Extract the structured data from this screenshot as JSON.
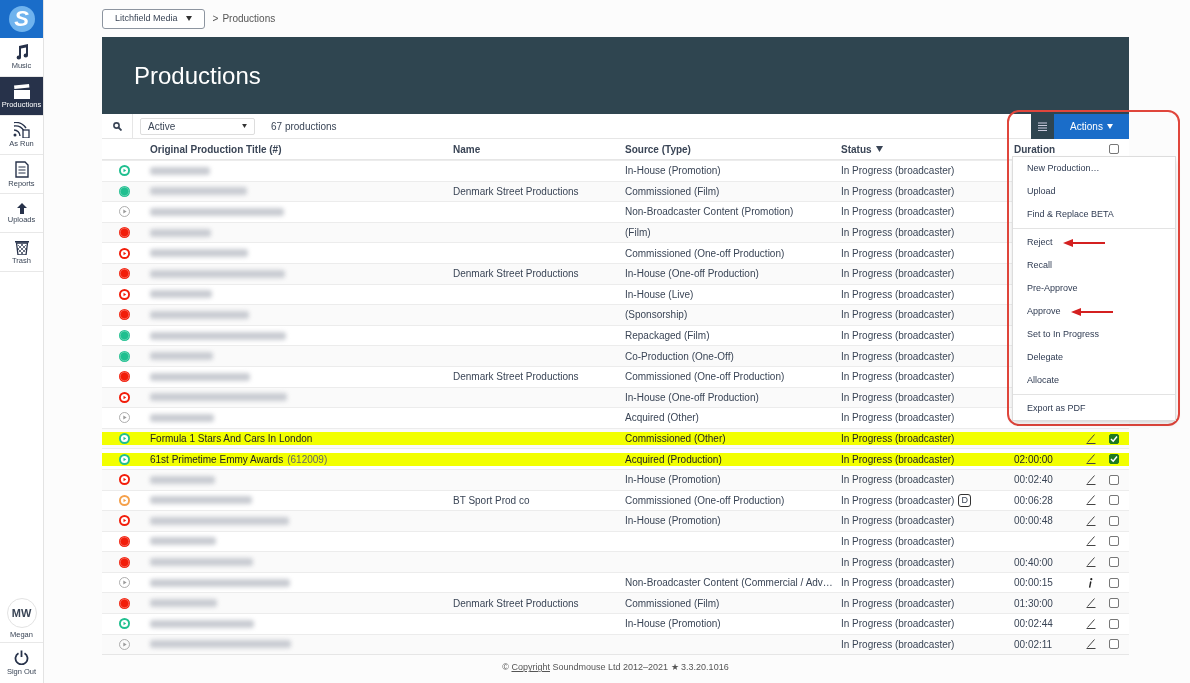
{
  "sidebar": {
    "logo_text": "S",
    "items": [
      {
        "label": "Music",
        "kind": "music",
        "selected": false
      },
      {
        "label": "Productions",
        "kind": "clapper",
        "selected": true
      },
      {
        "label": "As Run",
        "kind": "asrun",
        "selected": false
      },
      {
        "label": "Reports",
        "kind": "report",
        "selected": false
      },
      {
        "label": "Uploads",
        "kind": "upload",
        "selected": false
      },
      {
        "label": "Trash",
        "kind": "trash",
        "selected": false
      }
    ],
    "user": {
      "initials": "MW",
      "name": "Megan"
    },
    "sign_out": "Sign Out"
  },
  "breadcrumb": {
    "account": "Litchfield Media",
    "separator": ">",
    "page": "Productions"
  },
  "page_title": "Productions",
  "toolbar": {
    "filter": "Active",
    "count": "67 productions",
    "actions_button": "Actions"
  },
  "table": {
    "columns": [
      "Original Production Title (#)",
      "Name",
      "Source (Type)",
      "Status",
      "Duration"
    ],
    "select_all_checked": false,
    "rows": [
      {
        "kind": "play",
        "color": "#1fbf8f",
        "redacted": true,
        "highlighted": false,
        "name": "",
        "source": "In-House (Promotion)",
        "status": "In Progress (broadcaster)"
      },
      {
        "kind": "dot",
        "color": "#1fbf8f",
        "redacted": true,
        "highlighted": false,
        "name": "Denmark Street Productions",
        "source": "Commissioned (Film)",
        "status": "In Progress (broadcaster)"
      },
      {
        "kind": "outline",
        "redacted": true,
        "highlighted": false,
        "name": "",
        "source": "Non-Broadcaster Content (Promotion)",
        "status": "In Progress (broadcaster)"
      },
      {
        "kind": "dot",
        "color": "#f21d0a",
        "redacted": true,
        "highlighted": false,
        "name": "",
        "source": "(Film)",
        "status": "In Progress (broadcaster)"
      },
      {
        "kind": "play",
        "color": "#f21d0a",
        "redacted": true,
        "highlighted": false,
        "name": "",
        "source": "Commissioned (One-off Production)",
        "status": "In Progress (broadcaster)"
      },
      {
        "kind": "dot",
        "color": "#f21d0a",
        "redacted": true,
        "highlighted": false,
        "name": "Denmark Street Productions",
        "source": "In-House (One-off Production)",
        "status": "In Progress (broadcaster)"
      },
      {
        "kind": "play",
        "color": "#f21d0a",
        "redacted": true,
        "highlighted": false,
        "name": "",
        "source": "In-House (Live)",
        "status": "In Progress (broadcaster)"
      },
      {
        "kind": "dot",
        "color": "#f21d0a",
        "redacted": true,
        "highlighted": false,
        "name": "",
        "source": "(Sponsorship)",
        "status": "In Progress (broadcaster)"
      },
      {
        "kind": "dot",
        "color": "#1fbf8f",
        "redacted": true,
        "highlighted": false,
        "name": "",
        "source": "Repackaged (Film)",
        "status": "In Progress (broadcaster)"
      },
      {
        "kind": "dot",
        "color": "#1fbf8f",
        "redacted": true,
        "highlighted": false,
        "name": "",
        "source": "Co-Production (One-Off)",
        "status": "In Progress (broadcaster)"
      },
      {
        "kind": "dot",
        "color": "#f21d0a",
        "redacted": true,
        "highlighted": false,
        "name": "Denmark Street Productions",
        "source": "Commissioned (One-off Production)",
        "status": "In Progress (broadcaster)"
      },
      {
        "kind": "play",
        "color": "#f21d0a",
        "redacted": true,
        "highlighted": false,
        "name": "",
        "source": "In-House (One-off Production)",
        "status": "In Progress (broadcaster)"
      },
      {
        "kind": "outline",
        "redacted": true,
        "highlighted": false,
        "name": "",
        "source": "Acquired (Other)",
        "status": "In Progress (broadcaster)"
      },
      {
        "kind": "play",
        "color": "#1fbf8f",
        "redacted": false,
        "title": "Formula 1 Stars And Cars In London",
        "highlighted": true,
        "name": "",
        "source": "Commissioned (Other)",
        "status": "In Progress (broadcaster)",
        "duration": "",
        "action": {
          "kind": "edit"
        },
        "checked": true
      },
      {
        "kind": "play",
        "color": "#1fbf8f",
        "redacted": false,
        "title": "61st Primetime Emmy Awards",
        "number": "(612009)",
        "highlighted": true,
        "name": "",
        "source": "Acquired (Production)",
        "status": "In Progress (broadcaster)",
        "duration": "02:00:00",
        "action": {
          "kind": "edit"
        },
        "checked": true
      },
      {
        "kind": "play",
        "color": "#f21d0a",
        "redacted": true,
        "highlighted": false,
        "name": "",
        "source": "In-House (Promotion)",
        "status": "In Progress (broadcaster)",
        "duration": "00:02:40",
        "action": {
          "kind": "edit"
        },
        "checked": false
      },
      {
        "kind": "play",
        "color": "#f5a04a",
        "redacted": true,
        "highlighted": false,
        "name": "BT Sport Prod co",
        "source": "Commissioned (One-off Production)",
        "status": "In Progress (broadcaster)",
        "badge": "D",
        "duration": "00:06:28",
        "action": {
          "kind": "edit"
        },
        "checked": false
      },
      {
        "kind": "play",
        "color": "#f21d0a",
        "redacted": true,
        "highlighted": false,
        "name": "",
        "source": "In-House (Promotion)",
        "status": "In Progress (broadcaster)",
        "duration": "00:00:48",
        "action": {
          "kind": "edit"
        },
        "checked": false
      },
      {
        "kind": "dot",
        "color": "#f21d0a",
        "redacted": true,
        "highlighted": false,
        "name": "",
        "source": "",
        "status": "In Progress (broadcaster)",
        "action": {
          "kind": "edit"
        },
        "checked": false
      },
      {
        "kind": "dot",
        "color": "#f21d0a",
        "redacted": true,
        "highlighted": false,
        "status": "In Progress (broadcaster)",
        "duration": "00:40:00",
        "action": {
          "kind": "edit"
        },
        "checked": false
      },
      {
        "kind": "outline",
        "redacted": true,
        "highlighted": false,
        "name": "",
        "source": "Non-Broadcaster Content (Commercial / Adv…",
        "status": "In Progress (broadcaster)",
        "duration": "00:00:15",
        "action": {
          "kind": "info"
        },
        "checked": false
      },
      {
        "kind": "dot",
        "color": "#f21d0a",
        "redacted": true,
        "highlighted": false,
        "name": "Denmark Street Productions",
        "source": "Commissioned (Film)",
        "status": "In Progress (broadcaster)",
        "duration": "01:30:00",
        "action": {
          "kind": "edit"
        },
        "checked": false
      },
      {
        "kind": "play",
        "color": "#1fbf8f",
        "redacted": true,
        "highlighted": false,
        "name": "",
        "source": "In-House (Promotion)",
        "status": "In Progress (broadcaster)",
        "duration": "00:02:44",
        "action": {
          "kind": "edit"
        },
        "checked": false
      },
      {
        "kind": "outline",
        "redacted": true,
        "highlighted": false,
        "status": "In Progress (broadcaster)",
        "duration": "00:02:11",
        "action": {
          "kind": "edit"
        },
        "checked": false
      }
    ]
  },
  "actions_menu": {
    "sections": [
      [
        {
          "label": "New Production…",
          "annotated": false
        },
        {
          "label": "Upload",
          "annotated": false
        },
        {
          "label": "Find & Replace BETA",
          "annotated": false
        }
      ],
      [
        {
          "label": "Reject",
          "annotated": true
        },
        {
          "label": "Recall",
          "annotated": false
        },
        {
          "label": "Pre-Approve",
          "annotated": false
        },
        {
          "label": "Approve",
          "annotated": true
        },
        {
          "label": "Set to In Progress",
          "annotated": false
        },
        {
          "label": "Delegate",
          "annotated": false
        },
        {
          "label": "Allocate",
          "annotated": false
        }
      ],
      [
        {
          "label": "Export as PDF",
          "annotated": false
        }
      ]
    ]
  },
  "footer": {
    "prefix": "©",
    "link": "Copyright",
    "text": "Soundmouse Ltd 2012–2021 ★ 3.3.20.1016"
  }
}
